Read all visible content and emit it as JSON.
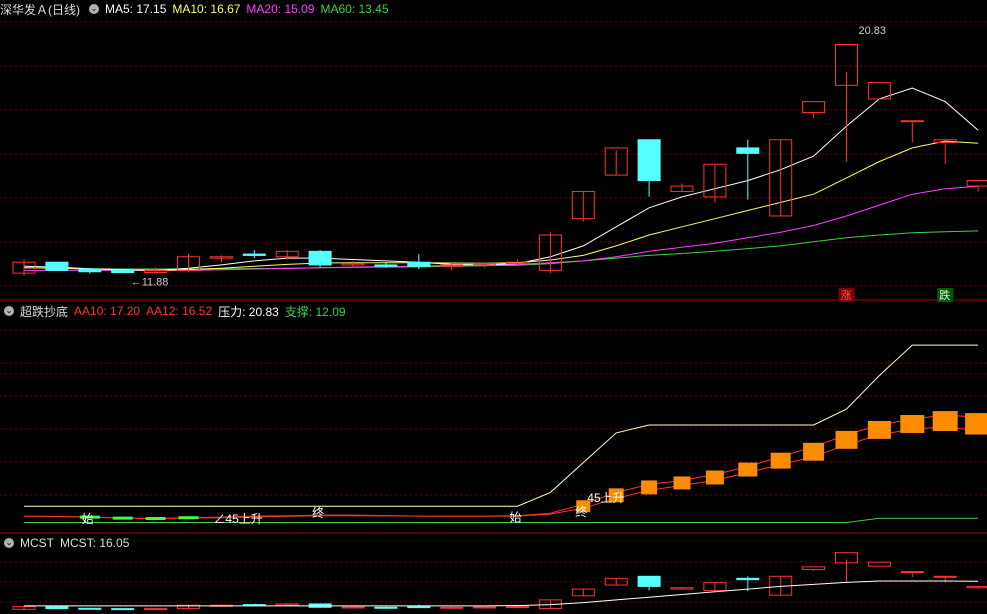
{
  "header1": {
    "title": "深华发Ａ(日线)",
    "ma5": "MA5: 17.15",
    "ma10": "MA10: 16.67",
    "ma20": "MA20: 15.09",
    "ma60": "MA60: 13.45"
  },
  "header2": {
    "title": "超跌抄底",
    "aa10": "AA10: 17.20",
    "aa12": "AA12: 16.52",
    "pressure": "压力: 20.83",
    "support": "支撑: 12.09"
  },
  "header3": {
    "title": "MCST",
    "mcst": "MCST: 16.05"
  },
  "price_labels": {
    "high": "20.83",
    "low": "←11.88",
    "zhang": "涨",
    "die": "跌"
  },
  "indicator_labels": {
    "shi1": "始",
    "up1": "∠45上升",
    "zhong1": "终",
    "shi2": "始",
    "zhong2": "终",
    "up2": "45上升"
  },
  "colors": {
    "up": "#ff3232",
    "down": "#54ffff",
    "ma5": "#ffffff",
    "ma10": "#ffff66",
    "ma20": "#ff40ff",
    "ma60": "#40d040",
    "orange": "#ff8c00",
    "grid": "#7a0000"
  },
  "chart_data": {
    "type": "candlestick",
    "ohlc": [
      [
        11.9,
        12.4,
        11.8,
        12.3
      ],
      [
        12.3,
        12.2,
        12.0,
        12.0
      ],
      [
        12.05,
        12.0,
        11.88,
        11.95
      ],
      [
        12.0,
        11.95,
        11.9,
        11.92
      ],
      [
        11.92,
        12.1,
        11.9,
        12.0
      ],
      [
        12.0,
        12.6,
        11.95,
        12.5
      ],
      [
        12.45,
        12.55,
        12.3,
        12.5
      ],
      [
        12.6,
        12.75,
        12.45,
        12.55
      ],
      [
        12.5,
        12.75,
        12.4,
        12.7
      ],
      [
        12.7,
        12.75,
        12.1,
        12.2
      ],
      [
        12.2,
        12.35,
        12.1,
        12.25
      ],
      [
        12.2,
        12.3,
        12.1,
        12.15
      ],
      [
        12.3,
        12.6,
        12.05,
        12.15
      ],
      [
        12.15,
        12.3,
        12.0,
        12.2
      ],
      [
        12.2,
        12.3,
        12.1,
        12.25
      ],
      [
        12.25,
        12.4,
        12.15,
        12.3
      ],
      [
        12.0,
        13.4,
        11.9,
        13.3
      ],
      [
        13.9,
        14.9,
        13.8,
        14.9
      ],
      [
        15.5,
        16.4,
        15.5,
        16.5
      ],
      [
        16.8,
        16.8,
        14.7,
        15.3
      ],
      [
        14.9,
        15.2,
        14.9,
        15.1
      ],
      [
        14.7,
        15.9,
        14.5,
        15.9
      ],
      [
        16.5,
        16.8,
        14.6,
        16.3
      ],
      [
        14.0,
        16.8,
        14.0,
        16.8
      ],
      [
        17.8,
        17.8,
        17.6,
        18.2
      ],
      [
        18.8,
        19.3,
        16.0,
        20.3
      ],
      [
        18.3,
        18.3,
        18.3,
        18.9
      ],
      [
        17.5,
        17.5,
        16.7,
        17.5
      ],
      [
        16.7,
        16.7,
        15.9,
        16.8
      ],
      [
        15.1,
        15.1,
        14.9,
        15.3
      ]
    ],
    "ma5": [
      12.15,
      12.12,
      12.06,
      12.02,
      12.0,
      12.08,
      12.2,
      12.35,
      12.45,
      12.45,
      12.4,
      12.35,
      12.3,
      12.22,
      12.2,
      12.25,
      12.5,
      12.9,
      13.6,
      14.3,
      14.7,
      15.0,
      15.3,
      15.7,
      16.2,
      17.3,
      18.3,
      18.7,
      18.2,
      17.15
    ],
    "ma10": [
      12.1,
      12.08,
      12.05,
      12.02,
      12.0,
      12.03,
      12.08,
      12.15,
      12.22,
      12.27,
      12.28,
      12.28,
      12.28,
      12.27,
      12.26,
      12.28,
      12.38,
      12.55,
      12.9,
      13.3,
      13.6,
      13.9,
      14.2,
      14.5,
      14.8,
      15.4,
      16.0,
      16.5,
      16.75,
      16.67
    ],
    "ma20": [
      12.0,
      12.0,
      12.0,
      12.0,
      12.0,
      12.0,
      12.02,
      12.05,
      12.07,
      12.1,
      12.12,
      12.14,
      12.16,
      12.18,
      12.2,
      12.22,
      12.28,
      12.35,
      12.5,
      12.7,
      12.85,
      13.0,
      13.2,
      13.4,
      13.65,
      14.0,
      14.4,
      14.8,
      15.0,
      15.09
    ],
    "ma60": [
      12.1,
      12.08,
      12.06,
      12.05,
      12.05,
      12.05,
      12.06,
      12.07,
      12.08,
      12.1,
      12.11,
      12.12,
      12.13,
      12.15,
      12.17,
      12.19,
      12.25,
      12.35,
      12.45,
      12.55,
      12.62,
      12.7,
      12.8,
      12.9,
      13.05,
      13.2,
      13.3,
      13.38,
      13.42,
      13.45
    ],
    "aa10": [
      12.2,
      12.18,
      12.15,
      12.1,
      12.08,
      12.12,
      12.15,
      12.2,
      12.22,
      12.25,
      12.25,
      12.23,
      12.2,
      12.2,
      12.2,
      12.22,
      12.35,
      12.8,
      13.4,
      13.8,
      14.0,
      14.3,
      14.7,
      15.2,
      15.7,
      16.3,
      16.8,
      17.1,
      17.3,
      17.2
    ],
    "aa12": [
      12.2,
      12.18,
      12.15,
      12.1,
      12.08,
      12.1,
      12.12,
      12.16,
      12.19,
      12.22,
      12.22,
      12.21,
      12.2,
      12.19,
      12.19,
      12.2,
      12.3,
      12.6,
      13.1,
      13.5,
      13.75,
      14.0,
      14.4,
      14.8,
      15.2,
      15.8,
      16.3,
      16.6,
      16.7,
      16.52
    ],
    "pressure": [
      12.7,
      12.7,
      12.7,
      12.7,
      12.7,
      12.7,
      12.7,
      12.7,
      12.7,
      12.7,
      12.7,
      12.7,
      12.7,
      12.7,
      12.7,
      12.7,
      13.4,
      14.9,
      16.4,
      16.8,
      16.8,
      16.8,
      16.8,
      16.8,
      16.8,
      17.6,
      19.3,
      20.83,
      20.83,
      20.83
    ],
    "support": [
      11.88,
      11.88,
      11.88,
      11.88,
      11.88,
      11.88,
      11.88,
      11.88,
      11.88,
      11.88,
      11.88,
      11.88,
      11.88,
      11.88,
      11.88,
      11.88,
      11.88,
      11.88,
      11.88,
      11.88,
      11.88,
      11.88,
      11.88,
      11.88,
      11.88,
      11.88,
      12.09,
      12.09,
      12.09,
      12.09
    ],
    "mcst": [
      12.4,
      12.4,
      12.4,
      12.4,
      12.4,
      12.4,
      12.4,
      12.4,
      12.4,
      12.4,
      12.4,
      12.4,
      12.4,
      12.4,
      12.4,
      12.45,
      12.6,
      12.9,
      13.3,
      13.7,
      14.1,
      14.5,
      14.9,
      15.3,
      15.6,
      15.9,
      16.1,
      16.1,
      16.1,
      16.05
    ]
  }
}
